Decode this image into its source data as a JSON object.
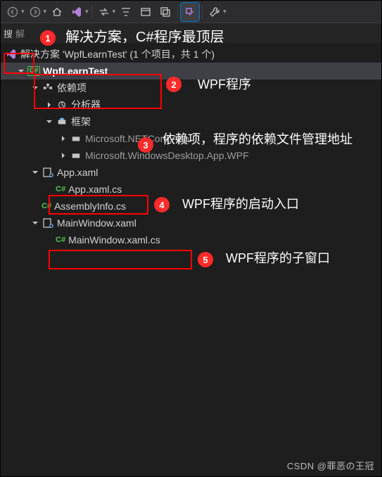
{
  "toolbar": {
    "icons": {
      "nav_back": "nav-back-icon",
      "nav_fwd": "nav-forward-icon",
      "home": "home-icon",
      "vs": "vs-icon",
      "sync": "sync-icon",
      "filter": "filter-icon",
      "collapse": "collapse-icon",
      "files": "files-icon",
      "show_all": "show-all-icon",
      "track": "track-icon",
      "wrench": "wrench-icon"
    }
  },
  "search": {
    "label": "搜",
    "partial": "解"
  },
  "tree": {
    "solution_prefix": "解决方案",
    "solution_name": "'WpfLearnTest'",
    "solution_suffix": "(1 个项目，共 1 个)",
    "project": "WpfLearnTest",
    "deps": "依赖项",
    "analyzer": "分析器",
    "framework": "框架",
    "fw1": "Microsoft.NETCord.App",
    "fw2": "Microsoft.WindowsDesktop.App.WPF",
    "app_xaml": "App.xaml",
    "app_xaml_cs": "App.xaml.cs",
    "assembly_info": "AssemblyInfo.cs",
    "main_window": "MainWindow.xaml",
    "main_window_cs": "MainWindow.xaml.cs"
  },
  "annotations": {
    "n1": "1",
    "n2": "2",
    "n3": "3",
    "n4": "4",
    "n5": "5",
    "a1": "解决方案，C#程序最顶层",
    "a2": "WPF程序",
    "a3": "依赖项，程序的依赖文件管理地址",
    "a4": "WPF程序的启动入口",
    "a5": "WPF程序的子窗口"
  },
  "watermark": "CSDN @罪恶の王冠"
}
